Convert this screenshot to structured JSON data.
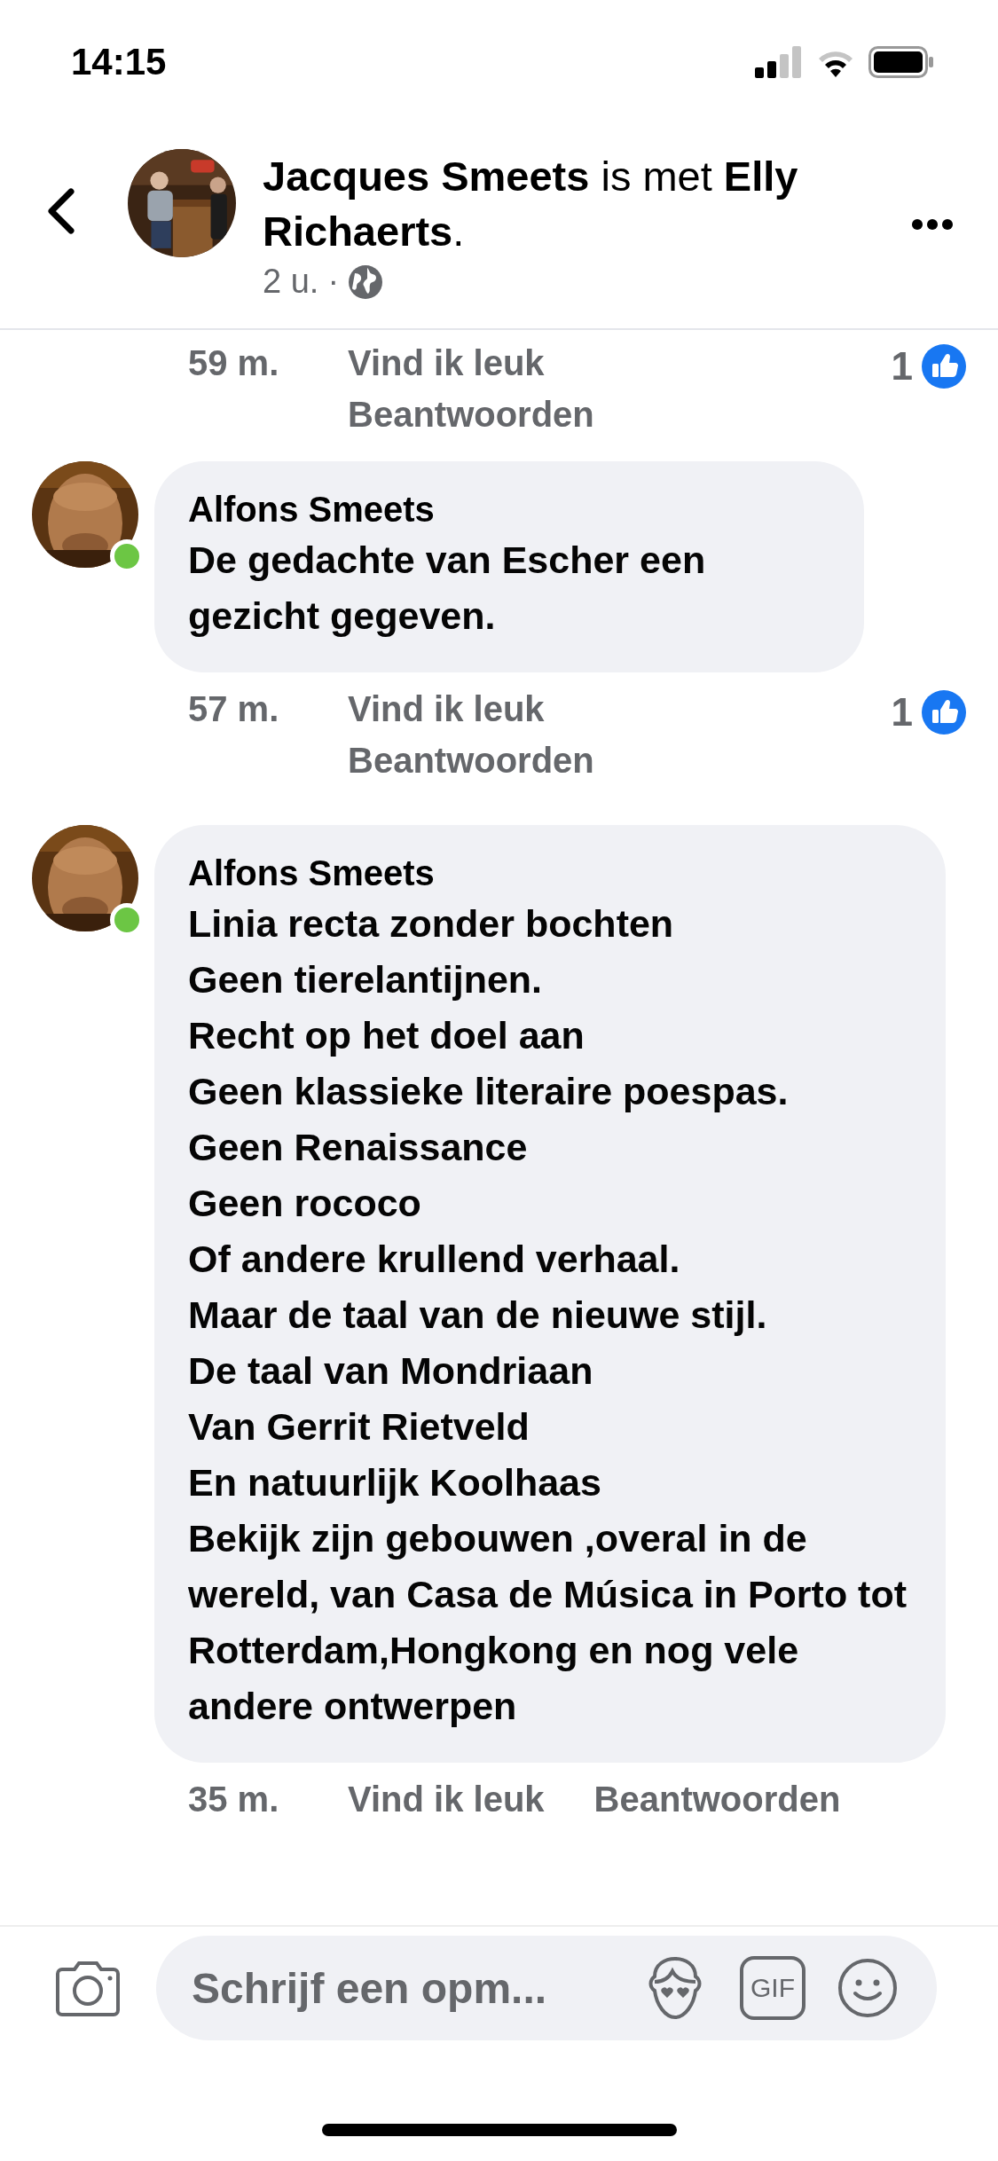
{
  "status_bar": {
    "time": "14:15"
  },
  "header": {
    "title": "**Jacques Smeets** is met **Elly Richaerts**.",
    "age": "2 u.",
    "separator": "·"
  },
  "comments": [
    {
      "kind": "partial",
      "time": "59 m.",
      "like_label": "Vind ik leuk",
      "reply_label": "Beantwoorden",
      "reactions": "1"
    },
    {
      "kind": "full",
      "author": "Alfons Smeets",
      "online": true,
      "text": "De gedachte van Escher een gezicht gegeven.",
      "time": "57 m.",
      "like_label": "Vind ik leuk",
      "reply_label": "Beantwoorden",
      "reactions": "1"
    },
    {
      "kind": "full",
      "author": "Alfons Smeets",
      "online": true,
      "text": "Linia recta zonder bochten\nGeen tierelantijnen.\nRecht op het doel aan\nGeen klassieke literaire poespas.\nGeen Renaissance\nGeen rococo\nOf andere krullend  verhaal.\nMaar de taal van de nieuwe stijl.\nDe taal van Mondriaan\nVan Gerrit Rietveld\nEn natuurlijk Koolhaas\nBekijk zijn gebouwen ,overal in de wereld, van Casa de Música in Porto tot Rotterdam,Hongkong en nog vele andere ontwerpen",
      "time": "35 m.",
      "like_label": "Vind ik leuk",
      "reply_label": "Beantwoorden"
    }
  ],
  "composer": {
    "placeholder": "Schrijf een opm...",
    "gif_label": "GIF"
  }
}
